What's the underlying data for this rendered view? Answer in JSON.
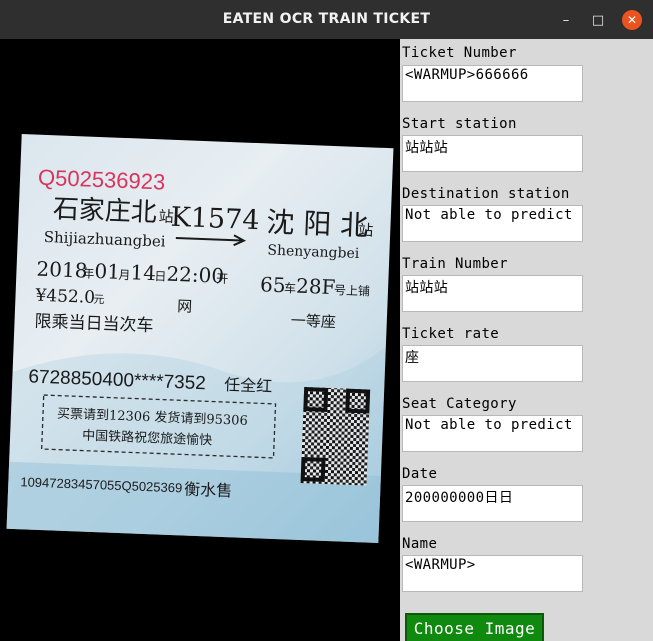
{
  "window": {
    "title": "EATEN OCR TRAIN TICKET",
    "controls": {
      "minimize": "–",
      "maximize": "□",
      "close": "✕"
    }
  },
  "ticket": {
    "serial": "Q502536923",
    "start_station_cn": "石家庄北",
    "start_station_suffix": "站",
    "start_station_pinyin": "Shijiazhuangbei",
    "train_no": "K1574",
    "dest_station_cn": "沈 阳 北",
    "dest_station_suffix": "站",
    "dest_station_pinyin": "Shenyangbei",
    "date_year": "2018",
    "date_y_unit": "年",
    "date_month": "01",
    "date_m_unit": "月",
    "date_day": "14",
    "date_d_unit": "日",
    "time": "22:00",
    "time_unit": "开",
    "coach": "65",
    "coach_unit": "车",
    "seat": "28F",
    "seat_unit": "号上铺",
    "price": "¥452.0",
    "price_unit": "元",
    "window_char": "网",
    "seat_class": "一等座",
    "validity": "限乘当日当次车",
    "id_number": "6728850400****7352",
    "passenger": "任全红",
    "notice_line1": "买票请到12306 发货请到95306",
    "notice_line2": "中国铁路祝您旅途愉快",
    "barcode": "10947283457055Q5025369",
    "sold_at": "衡水售"
  },
  "form": {
    "fields": [
      {
        "label": "Ticket Number",
        "value": "<WARMUP>666666"
      },
      {
        "label": "Start station",
        "value": "站站站"
      },
      {
        "label": "Destination station",
        "value": "Not able to predict"
      },
      {
        "label": "Train Number",
        "value": "站站站"
      },
      {
        "label": "Ticket rate",
        "value": "座"
      },
      {
        "label": "Seat Category",
        "value": "Not able to predict"
      },
      {
        "label": "Date",
        "value": "200000000日日"
      },
      {
        "label": "Name",
        "value": "<WARMUP>"
      }
    ],
    "choose_button": "Choose Image"
  },
  "colors": {
    "titlebar": "#2f2f2f",
    "close_button": "#e95420",
    "panel": "#d9d9d9",
    "ticket_serial": "#d8345c",
    "button_green": "#0f8a0f"
  }
}
